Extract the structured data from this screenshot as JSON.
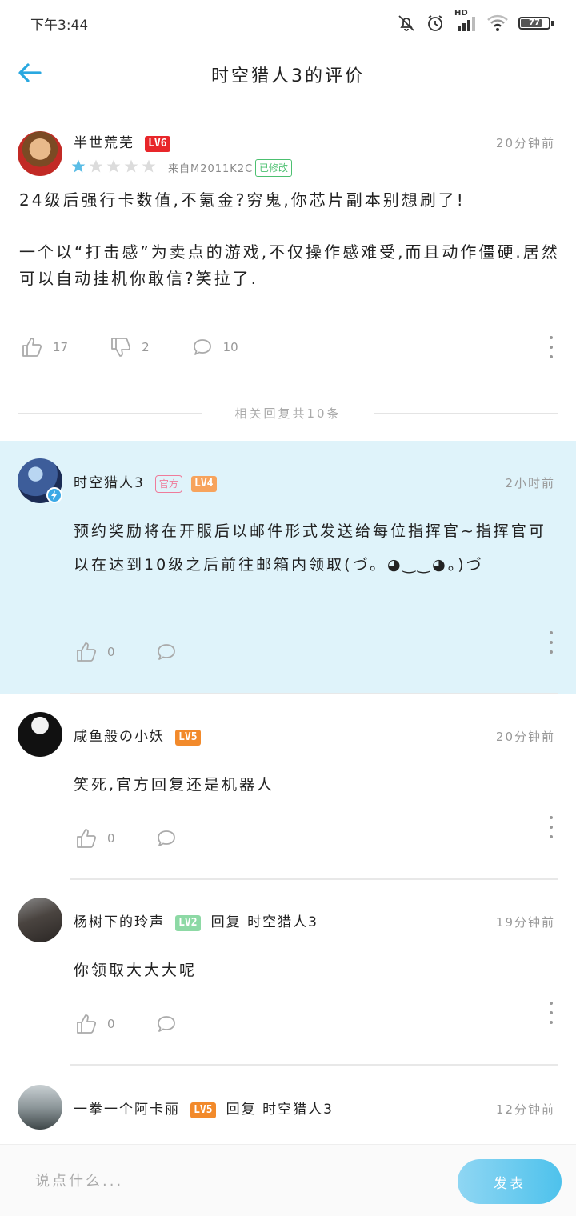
{
  "status_bar": {
    "time": "下午3:44",
    "hd_label": "HD",
    "battery": "77"
  },
  "header": {
    "title": "时空猎人3的评价"
  },
  "review": {
    "author": "半世荒芜",
    "level": "LV6",
    "level_color": "#e8262a",
    "rating": 1,
    "rating_max": 5,
    "device": "来自M2011K2C",
    "edited_tag": "已修改",
    "time": "20分钟前",
    "paragraphs": [
      "24级后强行卡数值,不氪金?穷鬼,你芯片副本别想刷了!",
      "一个以“打击感”为卖点的游戏,不仅操作感难受,而且动作僵硬.居然可以自动挂机你敢信?笑拉了."
    ],
    "likes": "17",
    "dislikes": "2",
    "comments": "10"
  },
  "divider_text": "相关回复共10条",
  "replies": [
    {
      "author": "时空猎人3",
      "official_tag": "官方",
      "level": "LV4",
      "level_color": "#f7a35c",
      "time": "2小时前",
      "text": "预约奖励将在开服后以邮件形式发送给每位指挥官~指挥官可以在达到10级之后前往邮箱内领取(づ。◕‿‿◕。)づ",
      "likes": "0"
    },
    {
      "author": "咸鱼般の小妖",
      "level": "LV5",
      "level_color": "#f28a2b",
      "time": "20分钟前",
      "text": "笑死,官方回复还是机器人",
      "likes": "0"
    },
    {
      "author": "杨树下的玲声",
      "level": "LV2",
      "level_color": "#8dd9a5",
      "reply_to": "回复 时空猎人3",
      "time": "19分钟前",
      "text": "你领取大大大呢",
      "likes": "0"
    },
    {
      "author": "一拳一个阿卡丽",
      "level": "LV5",
      "level_color": "#f28a2b",
      "reply_to": "回复 时空猎人3",
      "time": "12分钟前"
    }
  ],
  "composer": {
    "placeholder": "说点什么...",
    "publish_label": "发表"
  },
  "colors": {
    "accent": "#29a8e0",
    "highlight_bg": "#dff3fa"
  }
}
